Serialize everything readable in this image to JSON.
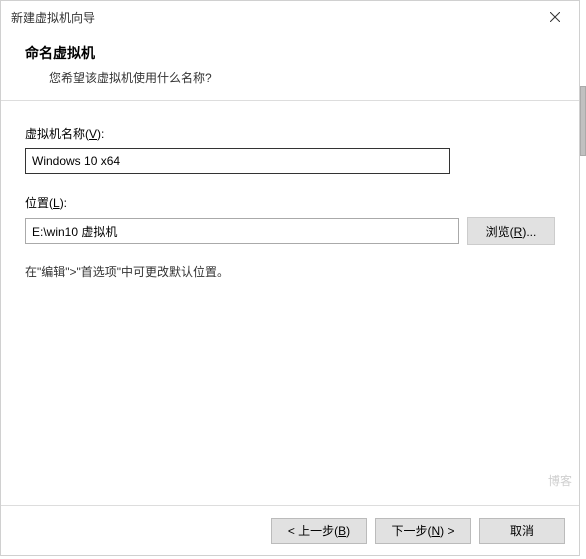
{
  "titlebar": {
    "title": "新建虚拟机向导"
  },
  "header": {
    "title": "命名虚拟机",
    "subtitle": "您希望该虚拟机使用什么名称?"
  },
  "fields": {
    "name_label_pre": "虚拟机名称(",
    "name_label_hotkey": "V",
    "name_label_post": "):",
    "name_value": "Windows 10 x64",
    "location_label_pre": "位置(",
    "location_label_hotkey": "L",
    "location_label_post": "):",
    "location_value": "E:\\win10 虚拟机",
    "browse_pre": "浏览(",
    "browse_hotkey": "R",
    "browse_post": ")..."
  },
  "hint": "在\"编辑\">\"首选项\"中可更改默认位置。",
  "footer": {
    "back_pre": "< 上一步(",
    "back_hotkey": "B",
    "back_post": ")",
    "next_pre": "下一步(",
    "next_hotkey": "N",
    "next_post": ") >",
    "cancel": "取消"
  },
  "watermark": "博客"
}
